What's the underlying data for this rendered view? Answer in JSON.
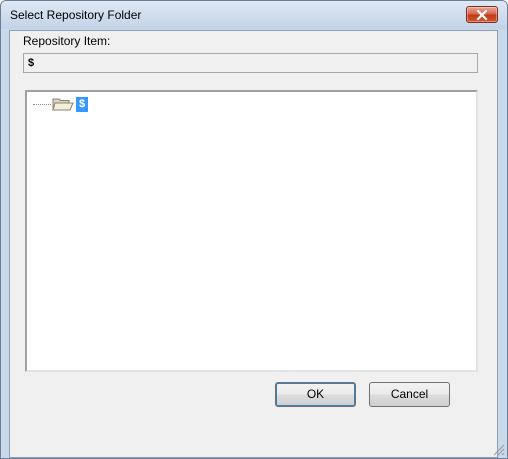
{
  "window": {
    "title": "Select Repository Folder"
  },
  "repository": {
    "label": "Repository Item:",
    "value": "$"
  },
  "tree": {
    "items": [
      {
        "label": "$",
        "selected": true,
        "icon": "folder-open-icon"
      }
    ]
  },
  "buttons": {
    "ok": "OK",
    "cancel": "Cancel"
  },
  "colors": {
    "selection": "#3399ff",
    "close_button": "#c23b1d"
  }
}
